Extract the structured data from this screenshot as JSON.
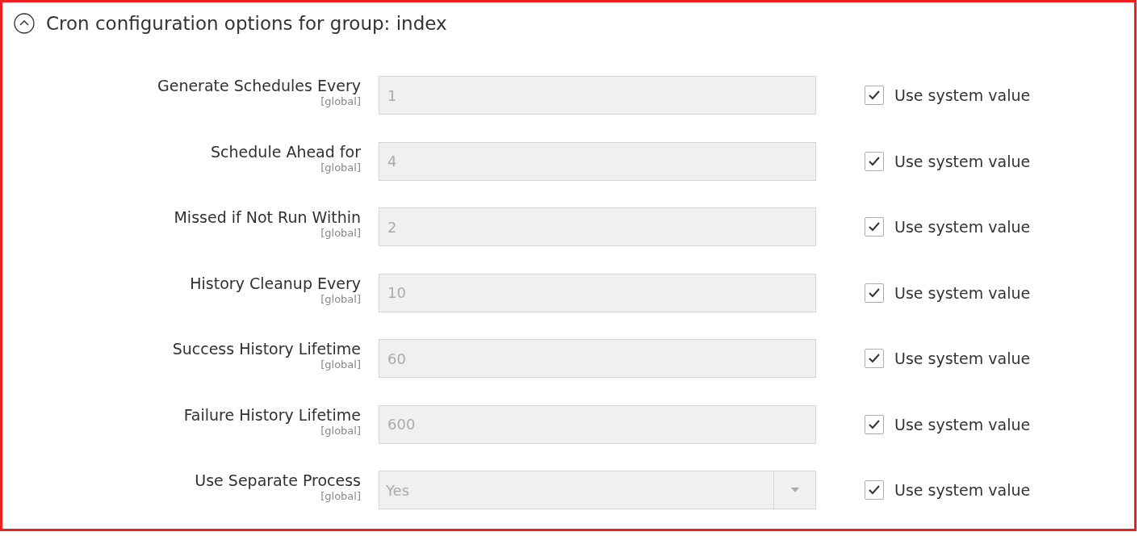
{
  "section": {
    "title": "Cron configuration options for group: index",
    "expanded": true
  },
  "fields": [
    {
      "label": "Generate Schedules Every",
      "scope": "[global]",
      "kind": "text",
      "value": "1",
      "disabled": true,
      "use_system": {
        "label": "Use system value",
        "checked": true
      }
    },
    {
      "label": "Schedule Ahead for",
      "scope": "[global]",
      "kind": "text",
      "value": "4",
      "disabled": true,
      "use_system": {
        "label": "Use system value",
        "checked": true
      }
    },
    {
      "label": "Missed if Not Run Within",
      "scope": "[global]",
      "kind": "text",
      "value": "2",
      "disabled": true,
      "use_system": {
        "label": "Use system value",
        "checked": true
      }
    },
    {
      "label": "History Cleanup Every",
      "scope": "[global]",
      "kind": "text",
      "value": "10",
      "disabled": true,
      "use_system": {
        "label": "Use system value",
        "checked": true
      }
    },
    {
      "label": "Success History Lifetime",
      "scope": "[global]",
      "kind": "text",
      "value": "60",
      "disabled": true,
      "use_system": {
        "label": "Use system value",
        "checked": true
      }
    },
    {
      "label": "Failure History Lifetime",
      "scope": "[global]",
      "kind": "text",
      "value": "600",
      "disabled": true,
      "use_system": {
        "label": "Use system value",
        "checked": true
      }
    },
    {
      "label": "Use Separate Process",
      "scope": "[global]",
      "kind": "select",
      "value": "Yes",
      "disabled": true,
      "use_system": {
        "label": "Use system value",
        "checked": true
      }
    }
  ]
}
